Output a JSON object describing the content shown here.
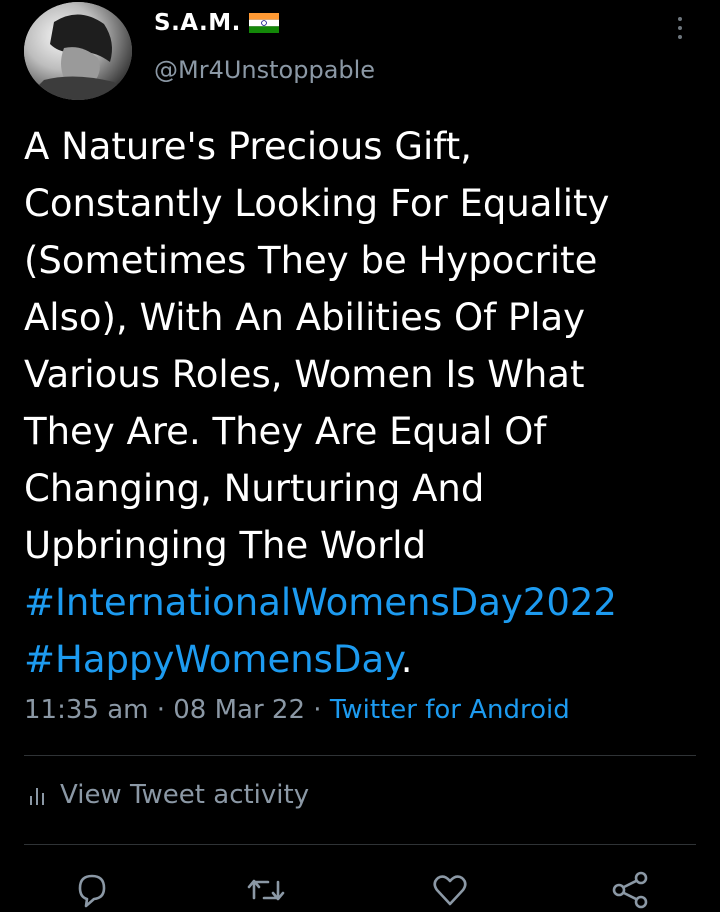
{
  "author": {
    "display_name": "S.A.M.",
    "handle": "@Mr4Unstoppable",
    "flag": "india-flag-icon"
  },
  "tweet": {
    "lines": [
      "A Nature's Precious Gift,",
      "Constantly  Looking For Equality",
      "(Sometimes They be Hypocrite",
      "Also), With An Abilities Of Play",
      "Various Roles, Women Is What",
      "They Are. They Are Equal Of",
      "Changing, Nurturing And",
      "Upbringing The World"
    ],
    "hashtags": [
      "#InternationalWomensDay2022",
      "#HappyWomensDay"
    ],
    "trailing_punctuation": "."
  },
  "meta": {
    "time": "11:35 am",
    "separator": "·",
    "date": "08 Mar 22",
    "source": "Twitter for Android"
  },
  "activity": {
    "label": "View Tweet activity",
    "icon": "bar-chart-icon"
  },
  "actions": {
    "icons": [
      "reply-icon",
      "retweet-icon",
      "like-icon",
      "share-icon"
    ]
  },
  "colors": {
    "background": "#000000",
    "text": "#ffffff",
    "secondary_text": "#8b98a5",
    "link": "#1d9bf0",
    "divider": "#2f3336"
  }
}
